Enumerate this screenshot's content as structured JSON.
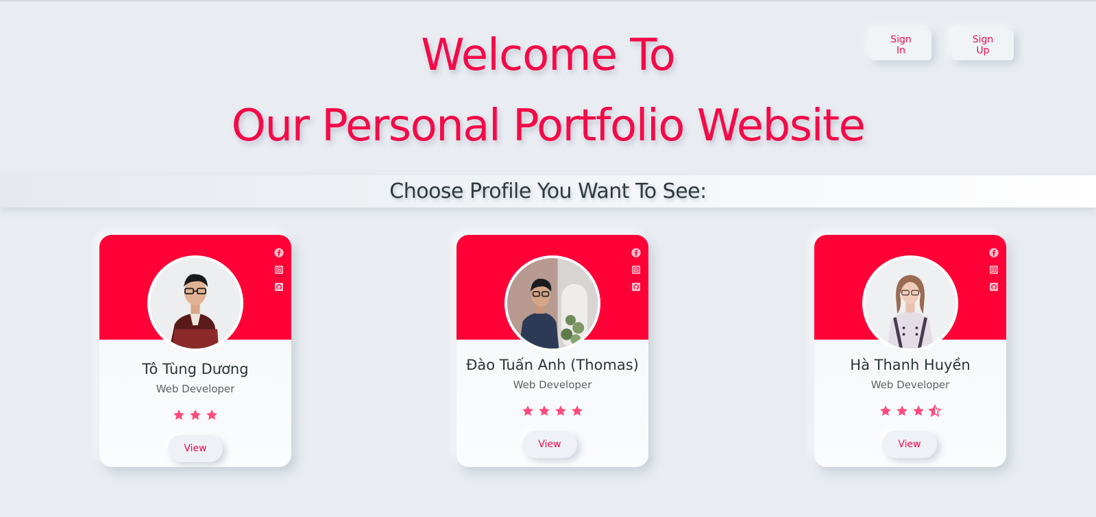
{
  "header": {
    "signin_label": "Sign In",
    "signup_label": "Sign Up"
  },
  "hero": {
    "line1": "Welcome To",
    "line2": "Our Personal Portfolio Website"
  },
  "band": {
    "text": "Choose Profile You Want To See:"
  },
  "colors": {
    "accent": "#ff0037",
    "accent_text": "#f40a48",
    "star": "#ff4d7d",
    "background": "#e9edf2"
  },
  "social_icons": [
    "facebook-icon",
    "instagram-icon",
    "github-icon"
  ],
  "profiles": [
    {
      "name": "Tô Tùng Dương",
      "role": "Web Developer",
      "rating": 3,
      "view_label": "View"
    },
    {
      "name": "Đào Tuấn Anh (Thomas)",
      "role": "Web Developer",
      "rating": 4,
      "view_label": "View"
    },
    {
      "name": "Hà Thanh Huyền",
      "role": "Web Developer",
      "rating": 3.5,
      "view_label": "View"
    }
  ]
}
